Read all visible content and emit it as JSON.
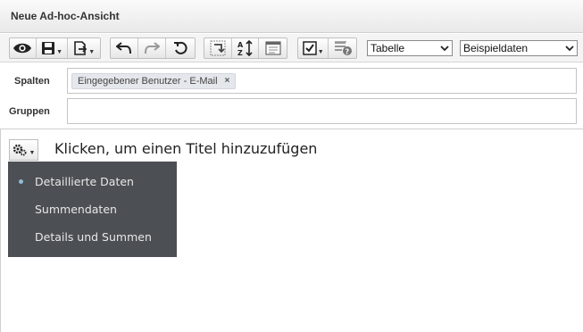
{
  "window": {
    "title": "Neue Ad-hoc-Ansicht"
  },
  "toolbar": {
    "icons": [
      "eye-icon",
      "save-icon",
      "export-icon",
      "undo-icon",
      "redo-icon",
      "undo-all-icon",
      "switch-axes-icon",
      "sort-icon",
      "properties-icon",
      "options-icon",
      "info-icon"
    ],
    "view_type_select": {
      "value": "Tabelle"
    },
    "data_mode_select": {
      "value": "Beispieldaten"
    }
  },
  "columns": {
    "label": "Spalten",
    "chips": [
      {
        "label": "Eingegebener Benutzer - E-Mail",
        "remove": "×"
      }
    ]
  },
  "groups": {
    "label": "Gruppen"
  },
  "canvas": {
    "title_placeholder": "Klicken, um einen Titel hinzuzufügen",
    "menu": {
      "items": [
        {
          "label": "Detaillierte Daten",
          "selected": true
        },
        {
          "label": "Summendaten",
          "selected": false
        },
        {
          "label": "Details und Summen",
          "selected": false
        }
      ]
    }
  },
  "colors": {
    "menu_bg": "#4c4f53",
    "selected_dot": "#8fbcd4",
    "chip_bg": "#e4e7ec"
  }
}
